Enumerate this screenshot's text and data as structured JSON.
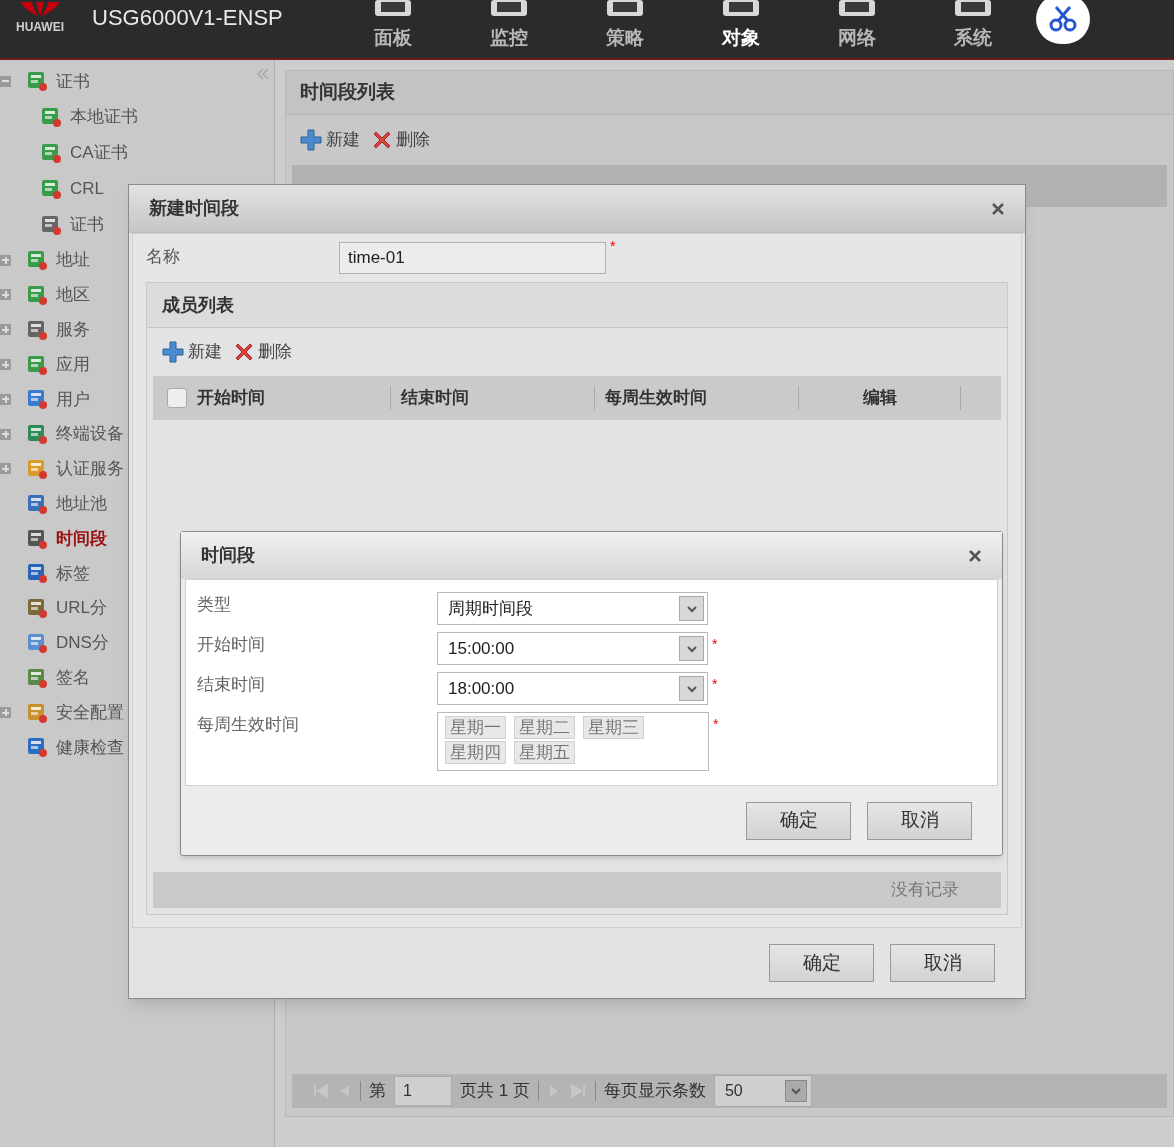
{
  "header": {
    "brand": "HUAWEI",
    "product": "USG6000V1-ENSP",
    "nav": [
      {
        "label": "面板",
        "selected": false
      },
      {
        "label": "监控",
        "selected": false
      },
      {
        "label": "策略",
        "selected": false
      },
      {
        "label": "对象",
        "selected": true
      },
      {
        "label": "网络",
        "selected": false
      },
      {
        "label": "系统",
        "selected": false
      }
    ]
  },
  "sidebar": {
    "items": [
      {
        "label": "证书",
        "kind": "folder",
        "expanded": true,
        "selected": false,
        "children": [
          {
            "label": "本地证书",
            "selected": false
          },
          {
            "label": "CA证书",
            "selected": false
          },
          {
            "label": "CRL",
            "selected": false
          },
          {
            "label": "证书",
            "selected": false
          }
        ]
      },
      {
        "label": "地址",
        "kind": "folder",
        "expanded": false,
        "selected": false
      },
      {
        "label": "地区",
        "kind": "folder",
        "expanded": false,
        "selected": false
      },
      {
        "label": "服务",
        "kind": "folder",
        "expanded": false,
        "selected": false
      },
      {
        "label": "应用",
        "kind": "folder",
        "expanded": false,
        "selected": false
      },
      {
        "label": "用户",
        "kind": "folder",
        "expanded": false,
        "selected": false
      },
      {
        "label": "终端设备",
        "kind": "folder",
        "expanded": false,
        "selected": false
      },
      {
        "label": "认证服务",
        "kind": "folder",
        "expanded": false,
        "selected": false
      },
      {
        "label": "地址池",
        "kind": "leaf",
        "selected": false
      },
      {
        "label": "时间段",
        "kind": "leaf",
        "selected": true
      },
      {
        "label": "标签",
        "kind": "leaf",
        "selected": false
      },
      {
        "label": "URL分",
        "kind": "leaf",
        "selected": false
      },
      {
        "label": "DNS分",
        "kind": "leaf",
        "selected": false
      },
      {
        "label": "签名",
        "kind": "leaf",
        "selected": false
      },
      {
        "label": "安全配置",
        "kind": "folder",
        "expanded": false,
        "selected": false
      },
      {
        "label": "健康检查",
        "kind": "leaf",
        "selected": false
      }
    ]
  },
  "main": {
    "title": "时间段列表",
    "toolbar": [
      {
        "label": "新建",
        "kind": "add"
      },
      {
        "label": "删除",
        "kind": "delete"
      }
    ],
    "pager": {
      "page_label": "第",
      "page": "1",
      "total": "页共 1 页",
      "page_size_label": "每页显示条数",
      "page_size": "50"
    }
  },
  "dialog": {
    "title": "新建时间段",
    "name_label": "名称",
    "name_value": "time-01",
    "name_required": true,
    "required_mark": "*",
    "members": {
      "title": "成员列表",
      "toolbar": [
        {
          "label": "新建",
          "kind": "add"
        },
        {
          "label": "删除",
          "kind": "delete"
        }
      ],
      "select_all": {
        "checked": false
      },
      "columns": [
        "开始时间",
        "结束时间",
        "每周生效时间",
        "编辑"
      ],
      "empty_text": "没有记录"
    },
    "buttons": [
      "确定",
      "取消"
    ]
  },
  "subdialog": {
    "title": "时间段",
    "required_mark": "*",
    "fields": [
      {
        "label": "类型",
        "kind": "select",
        "value": "周期时间段",
        "required": false
      },
      {
        "label": "开始时间",
        "kind": "select",
        "value": "15:00:00",
        "required": true
      },
      {
        "label": "结束时间",
        "kind": "select",
        "value": "18:00:00",
        "required": true
      },
      {
        "label": "每周生效时间",
        "kind": "tags",
        "values": [
          "星期一",
          "星期二",
          "星期三",
          "星期四",
          "星期五"
        ],
        "required": true
      }
    ],
    "buttons": [
      "确定",
      "取消"
    ]
  }
}
